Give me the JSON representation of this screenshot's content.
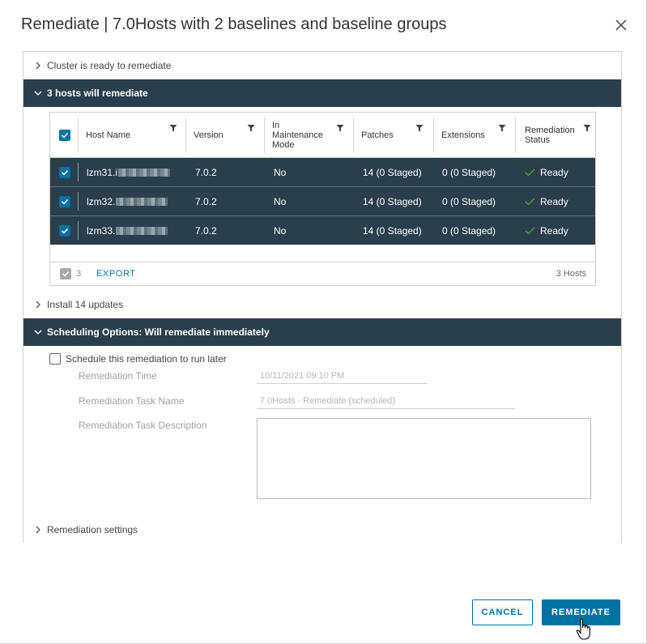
{
  "dialog": {
    "title": "Remediate | 7.0Hosts with 2 baselines and baseline groups"
  },
  "sections": {
    "cluster_ready": "Cluster is ready to remediate",
    "hosts_will_remediate": "3 hosts will remediate",
    "install_updates": "Install 14 updates",
    "scheduling": "Scheduling Options: Will remediate immediately",
    "remediation_settings": "Remediation settings"
  },
  "grid": {
    "columns": {
      "host_name": "Host Name",
      "version": "Version",
      "maintenance_1": "In",
      "maintenance_2": "Maintenance",
      "maintenance_3": "Mode",
      "patches": "Patches",
      "extensions": "Extensions",
      "status_1": "Remediation",
      "status_2": "Status"
    },
    "rows": [
      {
        "host": "lzm31.i",
        "version": "7.0.2",
        "maintenance": "No",
        "patches": "14 (0 Staged)",
        "extensions": "0 (0 Staged)",
        "status": "Ready"
      },
      {
        "host": "lzm32.",
        "version": "7.0.2",
        "maintenance": "No",
        "patches": "14 (0 Staged)",
        "extensions": "0 (0 Staged)",
        "status": "Ready"
      },
      {
        "host": "lzm33.",
        "version": "7.0.2",
        "maintenance": "No",
        "patches": "14 (0 Staged)",
        "extensions": "0 (0 Staged)",
        "status": "Ready"
      }
    ],
    "footer": {
      "selected_count": "3",
      "export_label": "EXPORT",
      "total": "3 Hosts"
    }
  },
  "scheduling": {
    "checkbox_label": "Schedule this remediation to run later",
    "time_label": "Remediation Time",
    "time_value": "10/11/2021 09:10 PM",
    "task_name_label": "Remediation Task Name",
    "task_name_value": "7.0Hosts - Remediate (scheduled)",
    "task_desc_label": "Remediation Task Description"
  },
  "buttons": {
    "cancel": "CANCEL",
    "remediate": "REMEDIATE"
  },
  "colors": {
    "accent": "#0072a3",
    "header_dark": "#2a3e4c",
    "ready_check": "#5aa220"
  }
}
